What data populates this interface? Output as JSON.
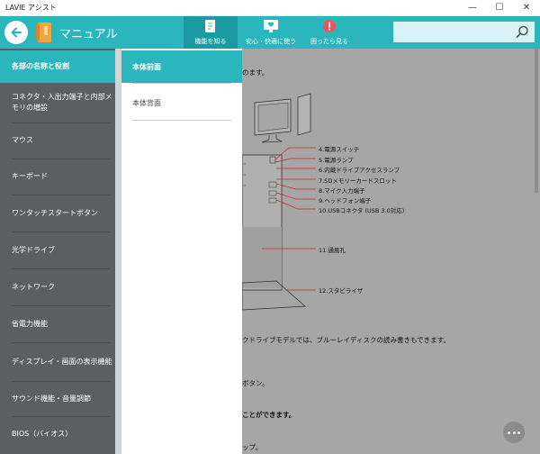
{
  "window": {
    "title": "LAVIE アシスト",
    "minimize": "—",
    "maximize": "☐",
    "close": "✕"
  },
  "header": {
    "app_title": "マニュアル",
    "nav": [
      {
        "label": "機能を知る"
      },
      {
        "label": "安心・快適に使う"
      },
      {
        "label": "困ったら見る"
      }
    ],
    "search_placeholder": ""
  },
  "sidebar": {
    "items": [
      {
        "label": "各部の名称と役割"
      },
      {
        "label": "コネクタ・入出力端子と内部メモリの増設"
      },
      {
        "label": "マウス"
      },
      {
        "label": "キーボード"
      },
      {
        "label": "ワンタッチスタートボタン"
      },
      {
        "label": "光学ドライブ"
      },
      {
        "label": "ネットワーク"
      },
      {
        "label": "省電力機能"
      },
      {
        "label": "ディスプレイ・画面の表示機能"
      },
      {
        "label": "サウンド機能・音量調節"
      },
      {
        "label": "BIOS（バイオス）"
      }
    ]
  },
  "subpanel": {
    "items": [
      {
        "label": "本体前面"
      },
      {
        "label": "本体背面"
      }
    ]
  },
  "content": {
    "intro": "のます。",
    "callouts": [
      "4.電源スイッチ",
      "5.電源ランプ",
      "6.内蔵ドライブアクセスランプ",
      "7.SDメモリーカードスロット",
      "8.マイク入力端子",
      "9.ヘッドフォン端子",
      "10.USBコネクタ (USB 3.0対応)",
      "11.通風孔",
      "12.スタビライザ"
    ],
    "para1": "クドライブモデルでは、ブルーレイディスクの読み書きもできます。",
    "para2": "ボタン。",
    "para3": "ことができます。",
    "para4": "ップ。"
  }
}
